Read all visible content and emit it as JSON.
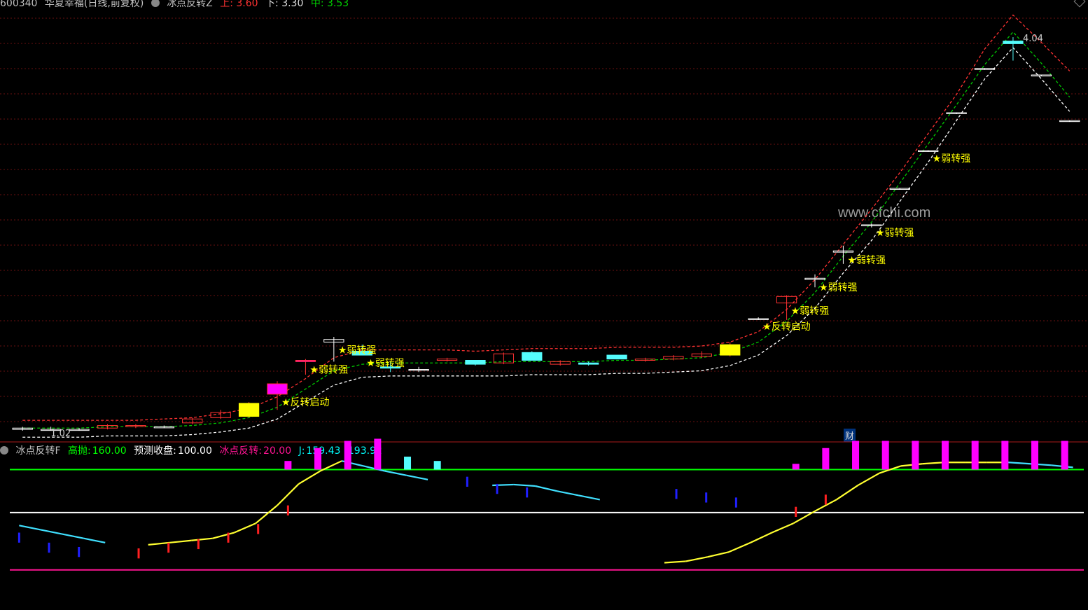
{
  "header": {
    "stock_code": "600340",
    "stock_name": "华夏幸福(日线,前复权)",
    "indicator": "冰点反转Z",
    "up_label": "上: 3.60",
    "down_label": "下: 3.30",
    "mid_label": "中: 3.53"
  },
  "lower_header": {
    "indicator": "冰点反转F",
    "high_label": "高抛:",
    "high_value": "160.00",
    "pred_label": "预测收盘:",
    "pred_value": "100.00",
    "ice_label": "冰点反转:",
    "ice_value": "20.00",
    "j_label": "J:",
    "j_value": "159.43",
    "j2_value": "193.92"
  },
  "watermark": "www.cfchi.com",
  "cai_badge": "财",
  "colors": {
    "background": "#000000",
    "up_candle": "#ff3232",
    "down_candle": "#54fcfc",
    "yellow": "#ffff00",
    "magenta": "#ff00ff",
    "red_band": "#ff3232",
    "green_band": "#00c800",
    "white_band": "#ffffff",
    "ref_line_green": "#00ff00",
    "grid": "#6a1010"
  },
  "chart_data": [
    {
      "type": "candlestick",
      "title": "冰点反转Z",
      "price_labels": {
        "max": "4.04",
        "min": "1.02"
      },
      "ylim": [
        0.95,
        4.25
      ],
      "candles": [
        {
          "o": 1.03,
          "h": 1.05,
          "l": 1.02,
          "c": 1.04,
          "k": "doji"
        },
        {
          "o": 1.03,
          "h": 1.05,
          "l": 1.02,
          "c": 1.03,
          "k": "doji"
        },
        {
          "o": 1.03,
          "h": 1.04,
          "l": 1.02,
          "c": 1.03,
          "k": "doji"
        },
        {
          "o": 1.04,
          "h": 1.07,
          "l": 1.03,
          "c": 1.06,
          "k": "up"
        },
        {
          "o": 1.05,
          "h": 1.07,
          "l": 1.04,
          "c": 1.06,
          "k": "up"
        },
        {
          "o": 1.05,
          "h": 1.06,
          "l": 1.04,
          "c": 1.05,
          "k": "doji"
        },
        {
          "o": 1.08,
          "h": 1.12,
          "l": 1.07,
          "c": 1.11,
          "k": "up"
        },
        {
          "o": 1.12,
          "h": 1.18,
          "l": 1.11,
          "c": 1.16,
          "k": "up"
        },
        {
          "o": 1.13,
          "h": 1.24,
          "l": 1.12,
          "c": 1.23,
          "k": "fill"
        },
        {
          "o": 1.38,
          "h": 1.4,
          "l": 1.18,
          "c": 1.3,
          "k": "upmag"
        },
        {
          "o": 1.55,
          "h": 1.57,
          "l": 1.45,
          "c": 1.56,
          "k": "mag"
        },
        {
          "o": 1.7,
          "h": 1.74,
          "l": 1.55,
          "c": 1.72,
          "k": "doji"
        },
        {
          "o": 1.63,
          "h": 1.68,
          "l": 1.62,
          "c": 1.6,
          "k": "down"
        },
        {
          "o": 1.51,
          "h": 1.55,
          "l": 1.47,
          "c": 1.5,
          "k": "down"
        },
        {
          "o": 1.49,
          "h": 1.51,
          "l": 1.47,
          "c": 1.49,
          "k": "doji"
        },
        {
          "o": 1.56,
          "h": 1.58,
          "l": 1.55,
          "c": 1.57,
          "k": "up"
        },
        {
          "o": 1.56,
          "h": 1.56,
          "l": 1.52,
          "c": 1.53,
          "k": "down"
        },
        {
          "o": 1.54,
          "h": 1.62,
          "l": 1.53,
          "c": 1.61,
          "k": "up"
        },
        {
          "o": 1.62,
          "h": 1.63,
          "l": 1.56,
          "c": 1.56,
          "k": "down"
        },
        {
          "o": 1.53,
          "h": 1.56,
          "l": 1.52,
          "c": 1.55,
          "k": "up"
        },
        {
          "o": 1.54,
          "h": 1.55,
          "l": 1.52,
          "c": 1.53,
          "k": "down"
        },
        {
          "o": 1.6,
          "h": 1.6,
          "l": 1.57,
          "c": 1.57,
          "k": "down"
        },
        {
          "o": 1.56,
          "h": 1.58,
          "l": 1.55,
          "c": 1.57,
          "k": "up"
        },
        {
          "o": 1.57,
          "h": 1.6,
          "l": 1.56,
          "c": 1.59,
          "k": "up"
        },
        {
          "o": 1.59,
          "h": 1.63,
          "l": 1.58,
          "c": 1.61,
          "k": "up"
        },
        {
          "o": 1.6,
          "h": 1.7,
          "l": 1.59,
          "c": 1.68,
          "k": "fill"
        },
        {
          "o": 1.88,
          "h": 1.89,
          "l": 1.87,
          "c": 1.88,
          "k": "doji"
        },
        {
          "o": 2.0,
          "h": 2.06,
          "l": 1.87,
          "c": 2.05,
          "k": "up"
        },
        {
          "o": 2.18,
          "h": 2.22,
          "l": 2.12,
          "c": 2.19,
          "k": "doji"
        },
        {
          "o": 2.39,
          "h": 2.44,
          "l": 2.3,
          "c": 2.4,
          "k": "doji"
        },
        {
          "o": 2.6,
          "h": 2.61,
          "l": 2.58,
          "c": 2.6,
          "k": "doji"
        },
        {
          "o": 2.88,
          "h": 2.88,
          "l": 2.87,
          "c": 2.88,
          "k": "doji"
        },
        {
          "o": 3.17,
          "h": 3.17,
          "l": 3.16,
          "c": 3.17,
          "k": "doji"
        },
        {
          "o": 3.46,
          "h": 3.46,
          "l": 3.45,
          "c": 3.46,
          "k": "doji"
        },
        {
          "o": 3.8,
          "h": 3.8,
          "l": 3.79,
          "c": 3.8,
          "k": "doji"
        },
        {
          "o": 4.01,
          "h": 4.04,
          "l": 3.86,
          "c": 3.99,
          "k": "down"
        },
        {
          "o": 3.75,
          "h": 3.75,
          "l": 3.74,
          "c": 3.75,
          "k": "doji"
        },
        {
          "o": 3.4,
          "h": 3.4,
          "l": 3.39,
          "c": 3.4,
          "k": "doji"
        }
      ],
      "bands": {
        "upper": [
          1.1,
          1.1,
          1.1,
          1.1,
          1.1,
          1.11,
          1.12,
          1.15,
          1.19,
          1.28,
          1.42,
          1.58,
          1.64,
          1.64,
          1.64,
          1.64,
          1.63,
          1.64,
          1.65,
          1.65,
          1.65,
          1.66,
          1.66,
          1.66,
          1.67,
          1.7,
          1.78,
          1.95,
          2.18,
          2.45,
          2.72,
          3.0,
          3.3,
          3.6,
          3.95,
          4.21,
          4.0,
          3.78
        ],
        "middle": [
          1.04,
          1.04,
          1.04,
          1.05,
          1.05,
          1.05,
          1.06,
          1.08,
          1.12,
          1.2,
          1.34,
          1.48,
          1.53,
          1.54,
          1.54,
          1.54,
          1.54,
          1.55,
          1.55,
          1.55,
          1.55,
          1.56,
          1.56,
          1.57,
          1.58,
          1.62,
          1.7,
          1.86,
          2.08,
          2.36,
          2.62,
          2.92,
          3.22,
          3.52,
          3.83,
          4.08,
          3.84,
          3.58
        ],
        "lower": [
          0.97,
          0.97,
          0.97,
          0.98,
          0.98,
          0.98,
          0.99,
          1.01,
          1.04,
          1.11,
          1.24,
          1.37,
          1.43,
          1.44,
          1.44,
          1.44,
          1.44,
          1.44,
          1.45,
          1.45,
          1.45,
          1.46,
          1.46,
          1.47,
          1.48,
          1.52,
          1.6,
          1.75,
          1.96,
          2.23,
          2.48,
          2.78,
          3.08,
          3.4,
          3.72,
          3.96,
          3.72,
          3.47
        ]
      },
      "signals": [
        {
          "i": 9,
          "text": "★反转启动"
        },
        {
          "i": 10,
          "text": "★弱转强"
        },
        {
          "i": 11,
          "text": "★弱转强"
        },
        {
          "i": 12,
          "text": "★弱转强"
        },
        {
          "i": 26,
          "text": "★反转启动"
        },
        {
          "i": 27,
          "text": "★弱转强"
        },
        {
          "i": 28,
          "text": "★弱转强"
        },
        {
          "i": 29,
          "text": "★弱转强"
        },
        {
          "i": 30,
          "text": "★弱转强"
        },
        {
          "i": 32,
          "text": "★弱转强"
        }
      ]
    },
    {
      "type": "line",
      "title": "冰点反转F",
      "ylim": [
        -35,
        180
      ],
      "ref_lines": [
        {
          "name": "高抛",
          "value": 160,
          "color": "#00ff00"
        },
        {
          "name": "预测收盘",
          "value": 100,
          "color": "#ffffff"
        },
        {
          "name": "冰点反转",
          "value": 20,
          "color": "#ff1493"
        }
      ],
      "j_line": [
        82,
        76,
        70,
        64,
        58,
        null,
        55,
        58,
        61,
        64,
        72,
        85,
        110,
        140,
        158,
        172,
        165,
        158,
        152,
        146,
        null,
        null,
        138,
        139,
        137,
        130,
        124,
        118,
        null,
        null,
        30,
        32,
        38,
        45,
        58,
        72,
        85,
        102,
        118,
        138,
        155,
        165,
        168,
        170,
        170,
        170,
        170,
        168,
        166,
        163
      ],
      "j_colors": [
        "c",
        "c",
        "c",
        "c",
        "c",
        "n",
        "y",
        "y",
        "y",
        "y",
        "y",
        "y",
        "y",
        "y",
        "y",
        "y",
        "c",
        "c",
        "c",
        "c",
        "n",
        "n",
        "c",
        "c",
        "c",
        "c",
        "c",
        "c",
        "n",
        "n",
        "y",
        "y",
        "y",
        "y",
        "y",
        "y",
        "y",
        "y",
        "y",
        "y",
        "y",
        "y",
        "y",
        "y",
        "y",
        "y",
        "y",
        "c",
        "c",
        "c"
      ],
      "bars": [
        {
          "i": 0,
          "v": 72,
          "c": "blue"
        },
        {
          "i": 1,
          "v": 58,
          "c": "blue"
        },
        {
          "i": 2,
          "v": 52,
          "c": "blue"
        },
        {
          "i": 4,
          "v": 50,
          "c": "red"
        },
        {
          "i": 5,
          "v": 58,
          "c": "red"
        },
        {
          "i": 6,
          "v": 63,
          "c": "red"
        },
        {
          "i": 7,
          "v": 72,
          "c": "red"
        },
        {
          "i": 8,
          "v": 84,
          "c": "red"
        },
        {
          "i": 9,
          "v": 110,
          "c": "red"
        },
        {
          "i": 9,
          "v": 172,
          "c": "magenta",
          "from": 160
        },
        {
          "i": 10,
          "v": 190,
          "c": "magenta",
          "from": 160
        },
        {
          "i": 11,
          "v": 200,
          "c": "magenta",
          "from": 160
        },
        {
          "i": 12,
          "v": 203,
          "c": "magenta",
          "from": 160
        },
        {
          "i": 13,
          "v": 178,
          "c": "cyan",
          "from": 160
        },
        {
          "i": 14,
          "v": 172,
          "c": "cyan",
          "from": 160
        },
        {
          "i": 15,
          "v": 150,
          "c": "blue"
        },
        {
          "i": 16,
          "v": 140,
          "c": "blue"
        },
        {
          "i": 17,
          "v": 135,
          "c": "blue"
        },
        {
          "i": 22,
          "v": 133,
          "c": "blue"
        },
        {
          "i": 23,
          "v": 128,
          "c": "blue"
        },
        {
          "i": 24,
          "v": 121,
          "c": "blue"
        },
        {
          "i": 26,
          "v": 108,
          "c": "red"
        },
        {
          "i": 27,
          "v": 125,
          "c": "red"
        },
        {
          "i": 26,
          "v": 168,
          "c": "magenta",
          "from": 160
        },
        {
          "i": 27,
          "v": 190,
          "c": "magenta",
          "from": 160
        },
        {
          "i": 28,
          "v": 200,
          "c": "magenta",
          "from": 160
        },
        {
          "i": 29,
          "v": 200,
          "c": "magenta",
          "from": 160
        },
        {
          "i": 30,
          "v": 200,
          "c": "magenta",
          "from": 160
        },
        {
          "i": 31,
          "v": 200,
          "c": "magenta",
          "from": 160
        },
        {
          "i": 32,
          "v": 200,
          "c": "magenta",
          "from": 160
        },
        {
          "i": 33,
          "v": 200,
          "c": "magenta",
          "from": 160
        },
        {
          "i": 34,
          "v": 200,
          "c": "magenta",
          "from": 160
        },
        {
          "i": 35,
          "v": 200,
          "c": "magenta",
          "from": 160
        }
      ]
    }
  ]
}
